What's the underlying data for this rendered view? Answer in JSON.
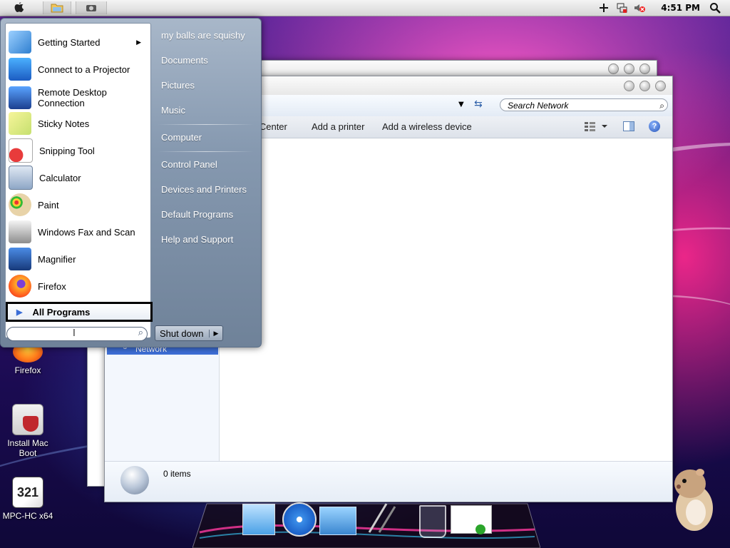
{
  "topbar": {
    "clock": "4:51 PM",
    "icons": [
      "apple-icon",
      "folder-icon",
      "camera-icon",
      "plus-icon",
      "network-icon",
      "volume-muted-icon",
      "search-icon"
    ]
  },
  "desktop": {
    "icons": [
      {
        "label": "Firefox"
      },
      {
        "label": "Install Mac Boot"
      },
      {
        "label": "MPC-HC x64"
      }
    ]
  },
  "explorer": {
    "search_placeholder": "Search Network",
    "command_bar": {
      "partial_item": "g Center",
      "add_printer": "Add a printer",
      "add_wireless": "Add a wireless device"
    },
    "nav_selected": "Network",
    "status_text": "0 items"
  },
  "start_menu": {
    "programs": [
      {
        "label": "Getting Started",
        "has_submenu": true
      },
      {
        "label": "Connect to a Projector"
      },
      {
        "label": "Remote Desktop Connection"
      },
      {
        "label": "Sticky Notes"
      },
      {
        "label": "Snipping Tool"
      },
      {
        "label": "Calculator"
      },
      {
        "label": "Paint"
      },
      {
        "label": "Windows Fax and Scan"
      },
      {
        "label": "Magnifier"
      },
      {
        "label": "Firefox"
      }
    ],
    "all_programs": "All Programs",
    "right_items": [
      "my balls are squishy",
      "Documents",
      "Pictures",
      "Music",
      "Computer",
      "Control Panel",
      "Devices and Printers",
      "Default Programs",
      "Help and Support"
    ],
    "shutdown_label": "Shut down"
  },
  "colors": {
    "start_menu": "#8699b0",
    "selection": "#3e6fd8",
    "accent_pink": "#ff4fc4"
  }
}
